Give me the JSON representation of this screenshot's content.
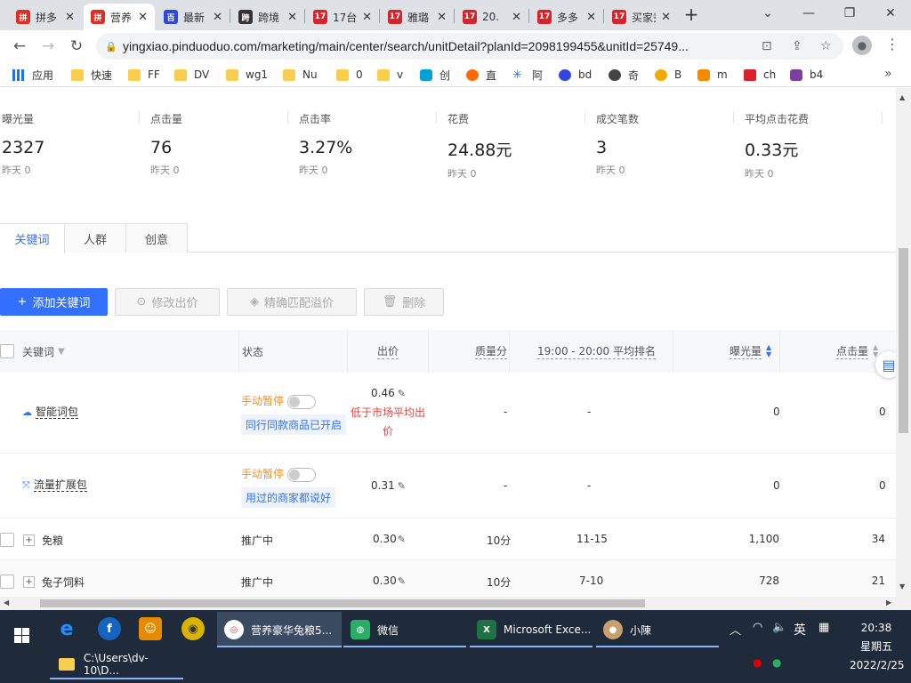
{
  "browser": {
    "tabs": [
      {
        "title": "拼多",
        "favicon_color": "#e02e24",
        "favicon_text": "拼",
        "active": false
      },
      {
        "title": "营养",
        "favicon_color": "#e02e24",
        "favicon_text": "拼",
        "active": true
      },
      {
        "title": "最新",
        "favicon_color": "#3245df",
        "favicon_text": "百",
        "active": false
      },
      {
        "title": "跨境",
        "favicon_color": "#333333",
        "favicon_text": "跨",
        "active": false
      },
      {
        "title": "17台",
        "favicon_color": "#d8232a",
        "favicon_text": "17",
        "active": false
      },
      {
        "title": "雅璐",
        "favicon_color": "#d8232a",
        "favicon_text": "17",
        "active": false
      },
      {
        "title": "20.",
        "favicon_color": "#d8232a",
        "favicon_text": "17",
        "active": false
      },
      {
        "title": "多多",
        "favicon_color": "#d8232a",
        "favicon_text": "17",
        "active": false
      },
      {
        "title": "买家秀",
        "favicon_color": "#d8232a",
        "favicon_text": "17",
        "active": false
      }
    ],
    "new_tab": "+",
    "window_controls": {
      "dropdown": "⌄",
      "minimize": "—",
      "restore": "❐",
      "close": "✕"
    },
    "url": "yingxiao.pinduoduo.com/marketing/main/center/search/unitDetail?planId=2098199455&unitId=25749...",
    "bookmarks": [
      {
        "label": "应用",
        "type": "apps"
      },
      {
        "label": "快速",
        "type": "folder"
      },
      {
        "label": "FF",
        "type": "folder"
      },
      {
        "label": "DV",
        "type": "folder"
      },
      {
        "label": "wg1",
        "type": "folder"
      },
      {
        "label": "Nu",
        "type": "folder"
      },
      {
        "label": "0",
        "type": "folder"
      },
      {
        "label": "v",
        "type": "folder"
      },
      {
        "label": "创",
        "type": "site"
      },
      {
        "label": "直",
        "type": "site"
      },
      {
        "label": "阿",
        "type": "site"
      },
      {
        "label": "bd",
        "type": "site"
      },
      {
        "label": "奇",
        "type": "site"
      },
      {
        "label": "B",
        "type": "site"
      },
      {
        "label": "m",
        "type": "site"
      },
      {
        "label": "ch",
        "type": "site"
      },
      {
        "label": "b4",
        "type": "site"
      }
    ],
    "bookmarks_more": "»"
  },
  "metrics": [
    {
      "label": "曝光量",
      "value": "2327",
      "unit": "",
      "prev": "昨天 0"
    },
    {
      "label": "点击量",
      "value": "76",
      "unit": "",
      "prev": "昨天 0"
    },
    {
      "label": "点击率",
      "value": "3.27%",
      "unit": "",
      "prev": "昨天 0"
    },
    {
      "label": "花费",
      "value": "24.88",
      "unit": "元",
      "prev": "昨天 0"
    },
    {
      "label": "成交笔数",
      "value": "3",
      "unit": "",
      "prev": "昨天 0"
    },
    {
      "label": "平均点击花费",
      "value": "0.33",
      "unit": "元",
      "prev": "昨天 0"
    }
  ],
  "page_tabs": [
    "关键词",
    "人群",
    "创意"
  ],
  "actions": {
    "add_keyword": "添加关键词",
    "modify_bid": "修改出价",
    "exact_match_premium": "精确匹配溢价",
    "delete": "删除"
  },
  "table": {
    "headers": {
      "keyword": "关键词",
      "status": "状态",
      "bid": "出价",
      "quality": "质量分",
      "avg_rank": "19:00 - 20:00 平均排名",
      "impressions": "曝光量",
      "clicks": "点击量"
    },
    "package_rows": [
      {
        "name": "智能词包",
        "icon": "cloud-icon",
        "status": "手动暂停",
        "hint": "同行同款商品已开启",
        "bid": "0.46",
        "warning": "低于市场平均出价",
        "quality": "-",
        "rank": "-",
        "impressions": "0",
        "clicks": "0"
      },
      {
        "name": "流量扩展包",
        "icon": "expand-icon",
        "status": "手动暂停",
        "hint": "用过的商家都说好",
        "bid": "0.31",
        "warning": "",
        "quality": "-",
        "rank": "-",
        "impressions": "0",
        "clicks": "0"
      }
    ],
    "keyword_rows": [
      {
        "name": "免粮",
        "status": "推广中",
        "bid": "0.30",
        "quality": "10分",
        "rank": "11-15",
        "impressions": "1,100",
        "clicks": "34"
      },
      {
        "name": "兔子饲料",
        "status": "推广中",
        "bid": "0.30",
        "quality": "10分",
        "rank": "7-10",
        "impressions": "728",
        "clicks": "21"
      }
    ]
  },
  "taskbar": {
    "apps": [
      {
        "label": "营养豪华兔粮5...",
        "color": "#ffffff",
        "active": true
      },
      {
        "label": "微信",
        "color": "#2aae67",
        "active": false
      },
      {
        "label": "Microsoft Exce...",
        "color": "#1f7244",
        "active": false
      },
      {
        "label": "小陳",
        "color": "#c8a070",
        "active": false
      }
    ],
    "explorer": "C:\\Users\\dv-10\\D...",
    "ime": "英",
    "time": "20:38",
    "weekday": "星期五",
    "date": "2022/2/25"
  }
}
